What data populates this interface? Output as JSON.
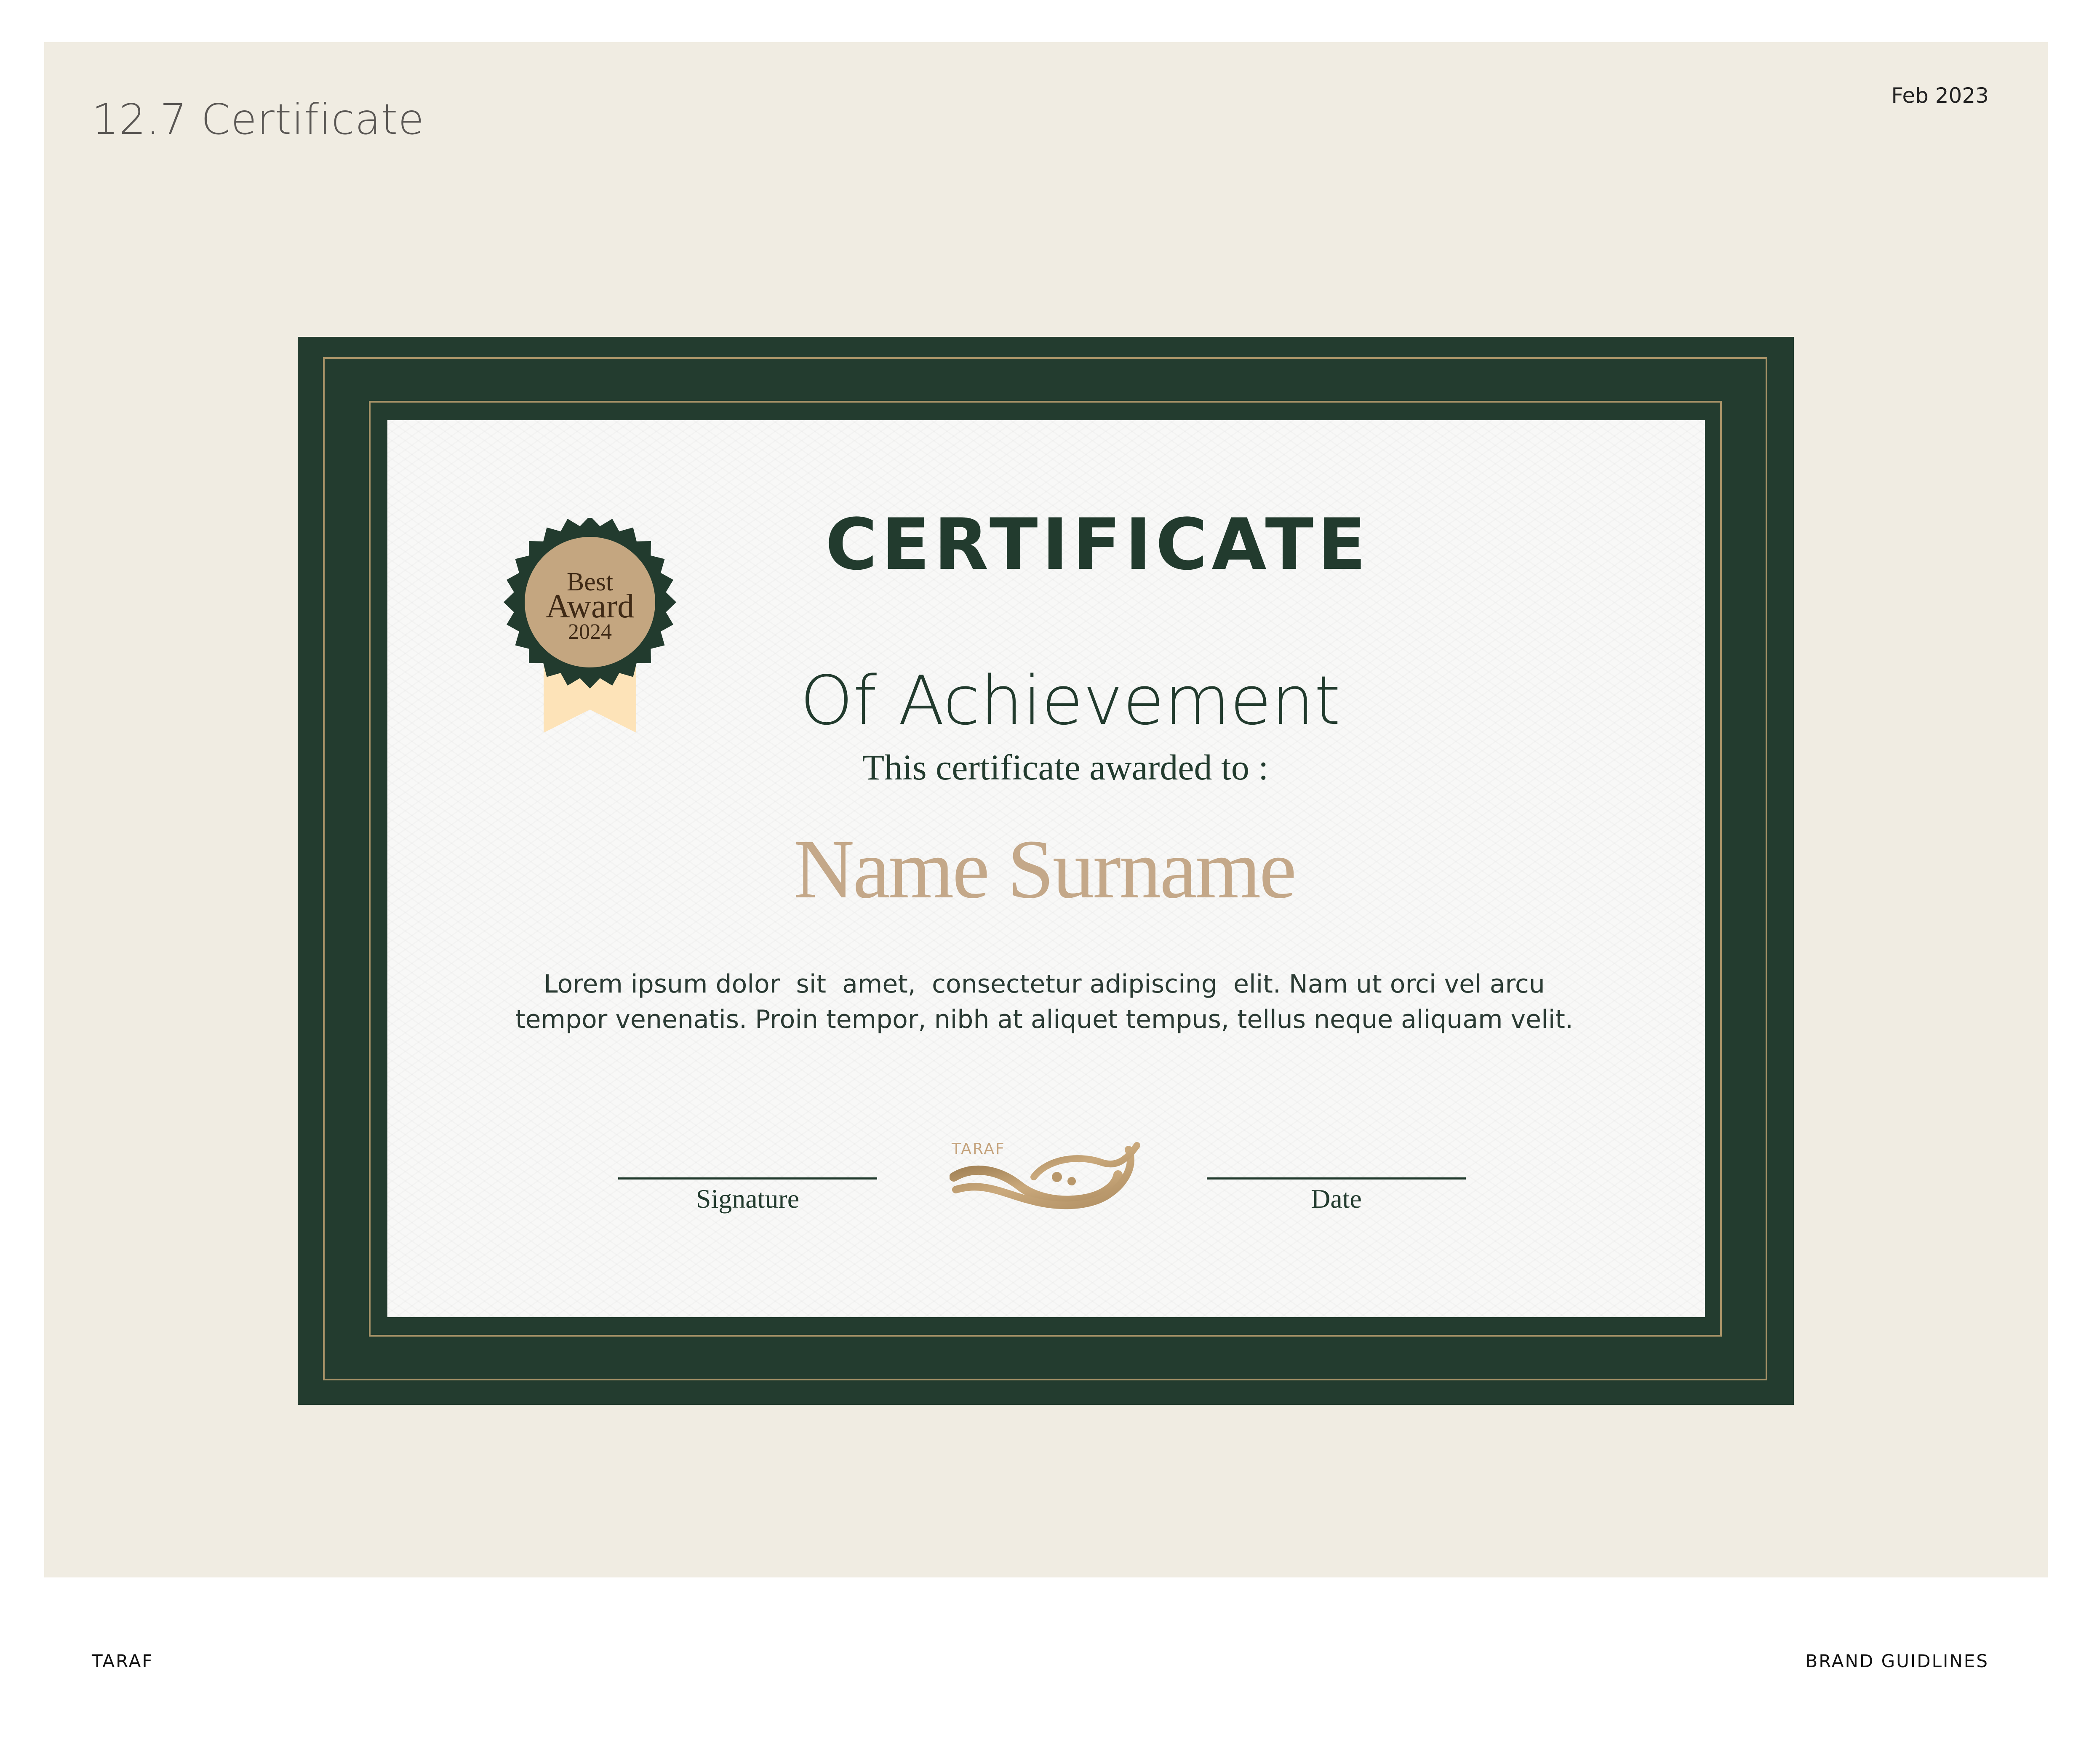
{
  "header": {
    "section_title": "12.7 Certificate",
    "date": "Feb 2023"
  },
  "certificate": {
    "title": "CERTIFICATE",
    "subtitle": "Of Achievement",
    "awarded_to": "This certificate awarded to :",
    "recipient_name": "Name Surname",
    "body_line_1": "Lorem ipsum dolor  sit  amet,  consectetur adipiscing  elit. Nam ut orci vel arcu",
    "body_line_2": "tempor venenatis. Proin tempor, nibh at aliquet tempus, tellus neque aliquam velit.",
    "signature_label": "Signature",
    "date_label": "Date",
    "badge": {
      "line_1": "Best",
      "line_2": "Award",
      "line_3": "2024"
    },
    "logo_wordmark": "TARAF"
  },
  "footer": {
    "brand": "TARAF",
    "document": "BRAND GUIDLINES"
  },
  "colors": {
    "panel_background": "#f0ece2",
    "frame_green": "#233c2f",
    "gold_rule": "#a89368",
    "name_gold": "#c4a889",
    "paper": "#f8f8f7"
  }
}
